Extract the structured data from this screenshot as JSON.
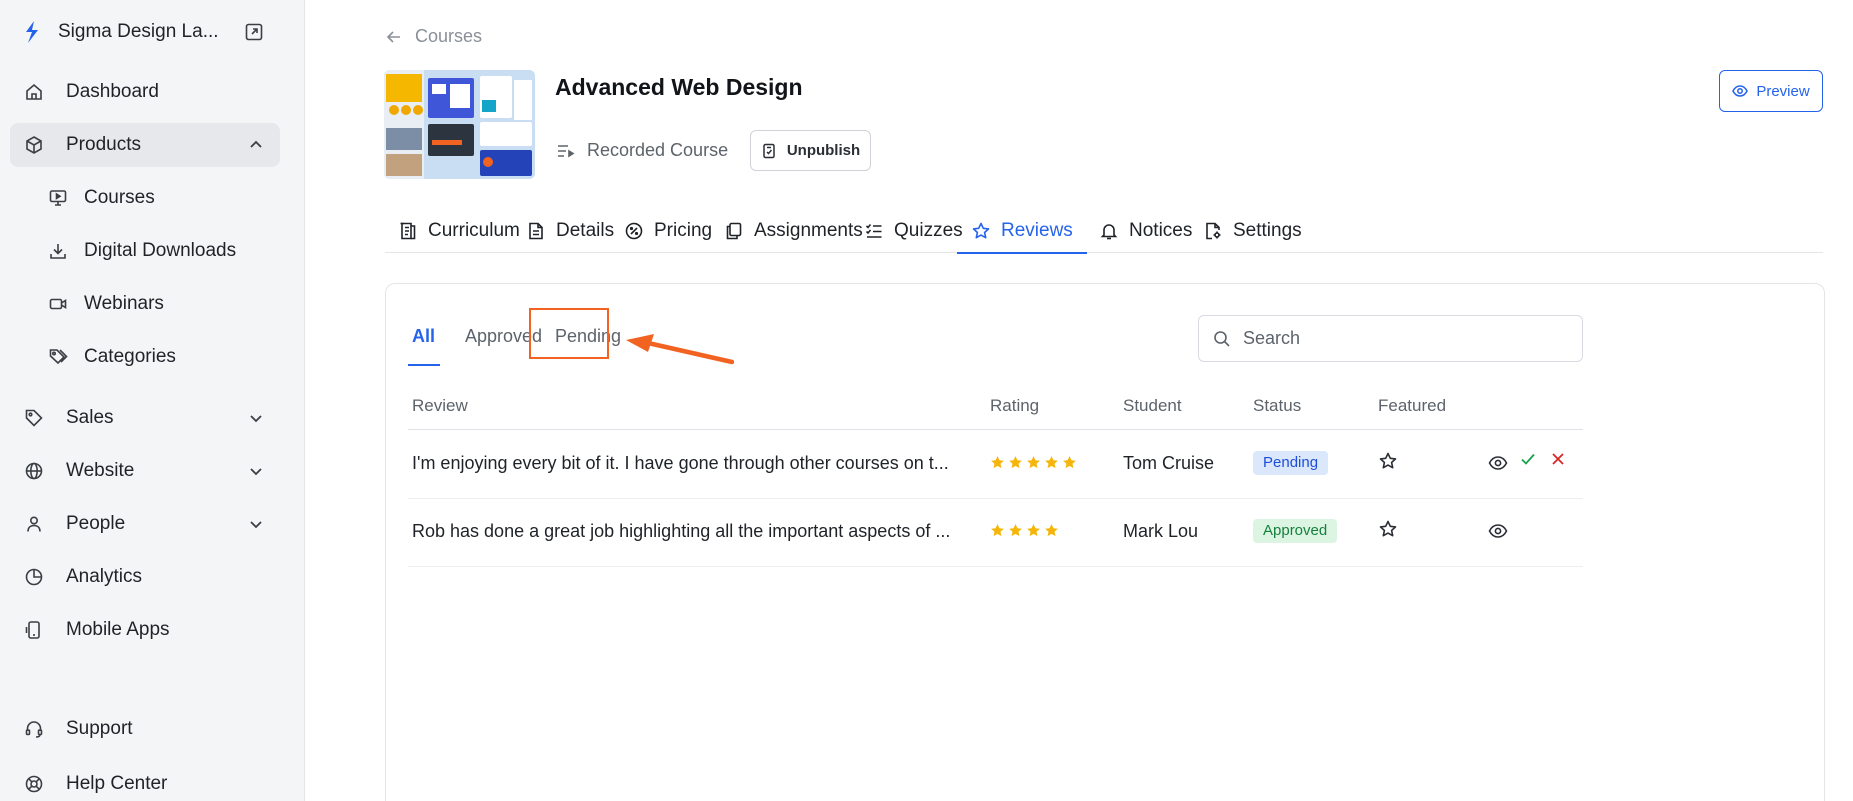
{
  "brand": {
    "name": "Sigma Design La..."
  },
  "sidebar": {
    "items": [
      {
        "label": "Dashboard",
        "icon": "home-icon"
      },
      {
        "label": "Products",
        "icon": "box-icon",
        "expanded": true
      },
      {
        "label": "Sales",
        "icon": "tag-icon"
      },
      {
        "label": "Website",
        "icon": "globe-icon"
      },
      {
        "label": "People",
        "icon": "person-icon"
      },
      {
        "label": "Analytics",
        "icon": "pie-chart-icon"
      },
      {
        "label": "Mobile Apps",
        "icon": "mobile-icon"
      },
      {
        "label": "Support",
        "icon": "headset-icon"
      },
      {
        "label": "Help Center",
        "icon": "lifebuoy-icon"
      }
    ],
    "products_sub": [
      {
        "label": "Courses",
        "icon": "monitor-icon"
      },
      {
        "label": "Digital Downloads",
        "icon": "download-icon"
      },
      {
        "label": "Webinars",
        "icon": "video-icon"
      },
      {
        "label": "Categories",
        "icon": "tags-icon"
      }
    ]
  },
  "header": {
    "back_label": "Courses",
    "course_title": "Advanced Web Design",
    "course_type": "Recorded Course",
    "unpublish_label": "Unpublish",
    "preview_label": "Preview"
  },
  "tabs": [
    {
      "label": "Curriculum",
      "icon": "curriculum-icon"
    },
    {
      "label": "Details",
      "icon": "document-icon"
    },
    {
      "label": "Pricing",
      "icon": "discount-icon"
    },
    {
      "label": "Assignments",
      "icon": "copy-icon"
    },
    {
      "label": "Quizzes",
      "icon": "checklist-icon"
    },
    {
      "label": "Reviews",
      "icon": "star-icon",
      "active": true
    },
    {
      "label": "Notices",
      "icon": "bell-icon"
    },
    {
      "label": "Settings",
      "icon": "settings-file-icon"
    }
  ],
  "reviews": {
    "filters": [
      {
        "label": "All",
        "active": true
      },
      {
        "label": "Approved"
      },
      {
        "label": "Pending"
      }
    ],
    "search_placeholder": "Search",
    "columns": {
      "review": "Review",
      "rating": "Rating",
      "student": "Student",
      "status": "Status",
      "featured": "Featured"
    },
    "rows": [
      {
        "review": "I'm enjoying every bit of it. I have gone through other courses on t...",
        "rating": 5,
        "student": "Tom Cruise",
        "status": "Pending"
      },
      {
        "review": "Rob has done a great job highlighting all the important aspects of ...",
        "rating": 4,
        "student": "Mark Lou",
        "status": "Approved"
      }
    ]
  },
  "colors": {
    "accent": "#2563eb",
    "highlight": "#f26322",
    "star": "#f5b50a",
    "approve": "#16a34a",
    "reject": "#dc2626"
  }
}
